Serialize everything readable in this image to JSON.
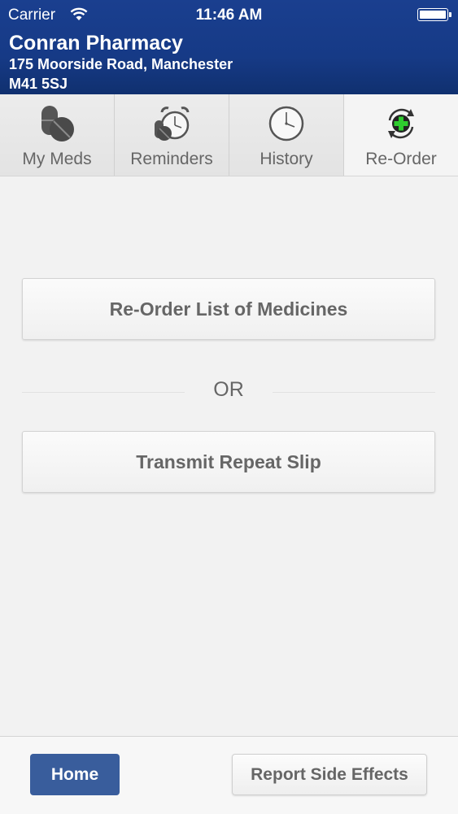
{
  "status_bar": {
    "carrier": "Carrier",
    "time": "11:46 AM",
    "wifi_icon": "wifi-icon",
    "battery_icon": "battery-icon"
  },
  "header": {
    "pharmacy_name": "Conran Pharmacy",
    "address_line1": "175 Moorside Road, Manchester",
    "address_line2": "M41 5SJ"
  },
  "tabs": [
    {
      "label": "My Meds",
      "icon": "pills-icon",
      "active": false
    },
    {
      "label": "Reminders",
      "icon": "alarm-clock-pill-icon",
      "active": false
    },
    {
      "label": "History",
      "icon": "clock-icon",
      "active": false
    },
    {
      "label": "Re-Order",
      "icon": "reorder-plus-icon",
      "active": true
    }
  ],
  "main": {
    "reorder_button": "Re-Order List of Medicines",
    "or_text": "OR",
    "transmit_button": "Transmit Repeat Slip"
  },
  "footer": {
    "home_button": "Home",
    "report_button": "Report Side Effects"
  },
  "colors": {
    "header_bg": "#163a86",
    "home_button_bg": "#395d9c",
    "reorder_plus": "#22cc22",
    "text_gray": "#666666"
  }
}
